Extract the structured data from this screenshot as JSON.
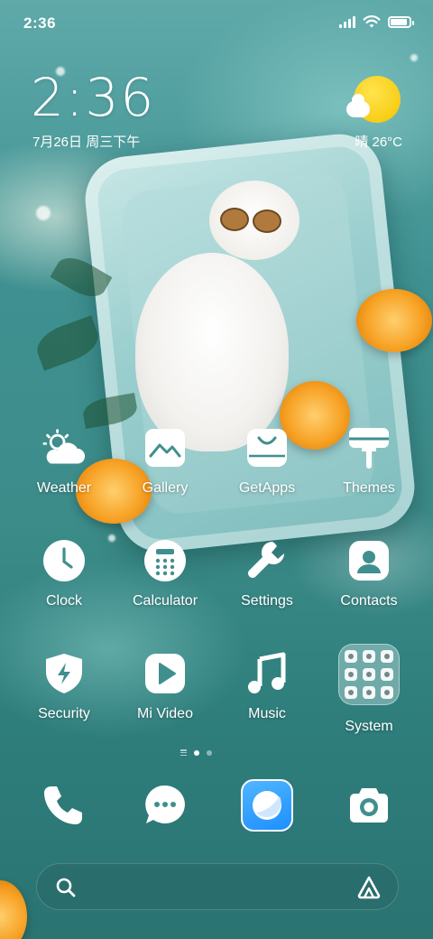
{
  "status_bar": {
    "time": "2:36",
    "battery_percent": 90
  },
  "widget": {
    "time": "2:36",
    "date": "7月26日 周三下午",
    "weather": "晴 26°C"
  },
  "apps": [
    {
      "label": "Weather",
      "icon": "weather-icon"
    },
    {
      "label": "Gallery",
      "icon": "gallery-icon"
    },
    {
      "label": "GetApps",
      "icon": "getapps-icon"
    },
    {
      "label": "Themes",
      "icon": "themes-icon"
    },
    {
      "label": "Clock",
      "icon": "clock-icon"
    },
    {
      "label": "Calculator",
      "icon": "calculator-icon"
    },
    {
      "label": "Settings",
      "icon": "settings-icon"
    },
    {
      "label": "Contacts",
      "icon": "contacts-icon"
    },
    {
      "label": "Security",
      "icon": "security-icon"
    },
    {
      "label": "Mi Video",
      "icon": "mi-video-icon"
    },
    {
      "label": "Music",
      "icon": "music-icon"
    },
    {
      "label": "System",
      "icon": "folder-icon"
    }
  ],
  "page_indicator": {
    "pages": 2,
    "current": 1
  },
  "dock": [
    {
      "icon": "phone-icon"
    },
    {
      "icon": "messages-icon"
    },
    {
      "icon": "browser-icon"
    },
    {
      "icon": "camera-icon"
    }
  ],
  "search": {
    "left_icon": "search-icon",
    "right_icon": "assistant-icon"
  },
  "colors": {
    "wallpaper_water": "#3f9191",
    "sun": "#f5c400",
    "browser": "#1e8fff",
    "icon": "#ffffff"
  }
}
